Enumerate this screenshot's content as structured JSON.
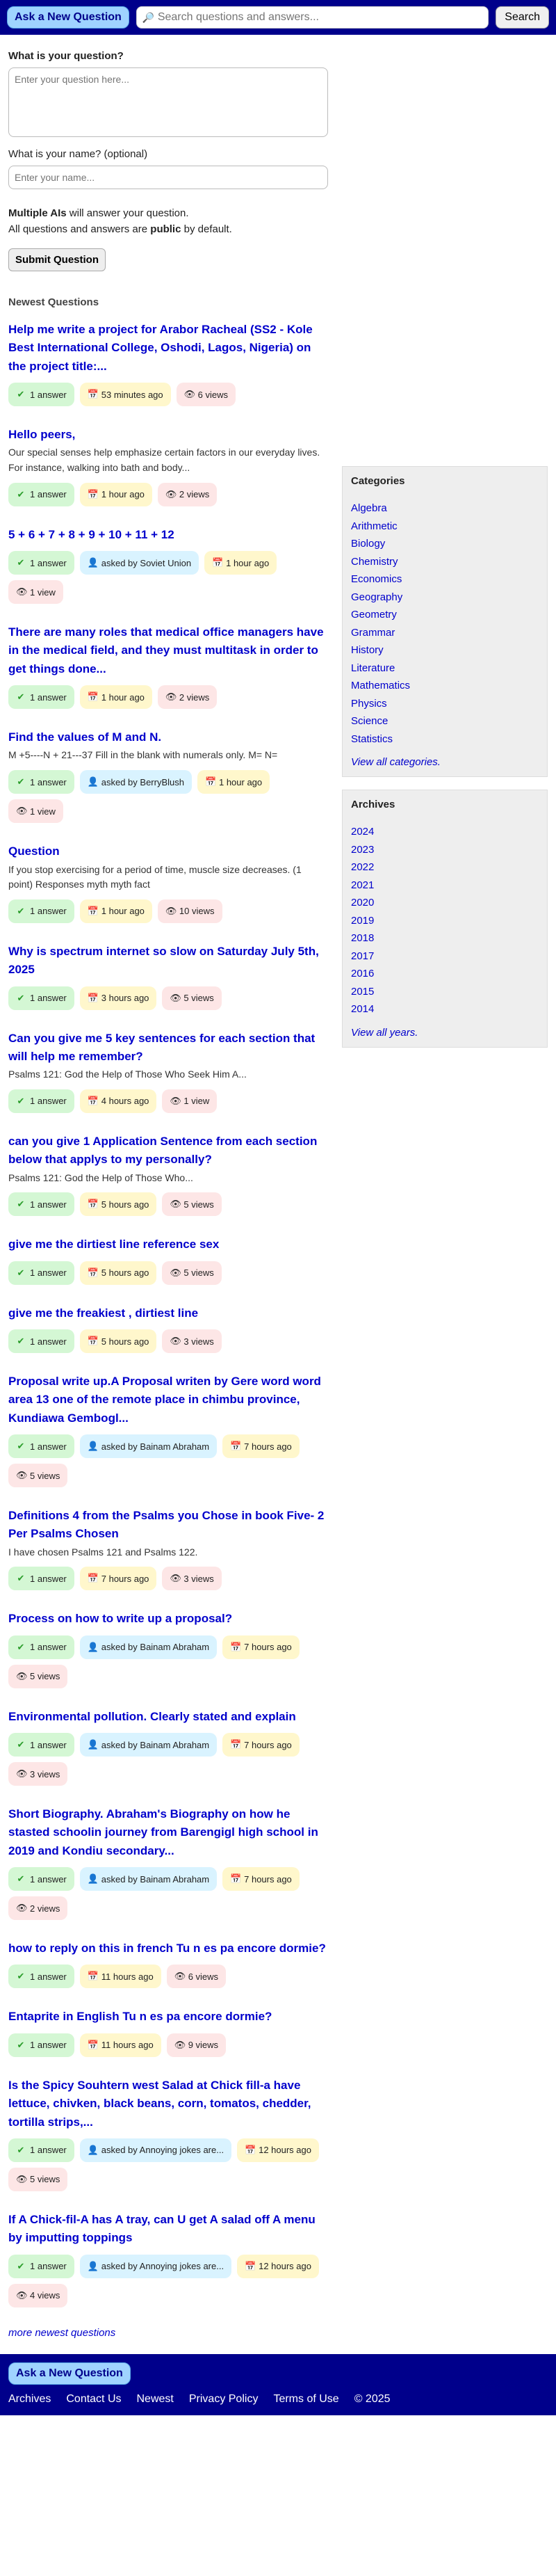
{
  "header": {
    "ask_label": "Ask a New Question",
    "search_placeholder": "Search questions and answers...",
    "search_button": "Search"
  },
  "form": {
    "question_label": "What is your question?",
    "question_placeholder": "Enter your question here...",
    "name_label": "What is your name? (optional)",
    "name_placeholder": "Enter your name...",
    "info_bold1": "Multiple AIs",
    "info_rest1": " will answer your question.",
    "info_pre2": "All questions and answers are ",
    "info_bold2": "public",
    "info_rest2": " by default.",
    "submit_label": "Submit Question"
  },
  "newest_title": "Newest Questions",
  "questions": [
    {
      "title": "Help me write a project for Arabor Racheal (SS2 - Kole Best International College, Oshodi, Lagos, Nigeria) on the project title:...",
      "answers": "1 answer",
      "time": "53 minutes ago",
      "views": "6 views"
    },
    {
      "title": "Hello peers,",
      "excerpt": "Our special senses help emphasize certain factors in our everyday lives. For instance, walking into bath and body...",
      "answers": "1 answer",
      "time": "1 hour ago",
      "views": "2 views"
    },
    {
      "title": "5 + 6 + 7 + 8 + 9 + 10 + 11 + 12",
      "answers": "1 answer",
      "user": "asked by Soviet Union",
      "time": "1 hour ago",
      "views": "1 view"
    },
    {
      "title": "There are many roles that medical office managers have in the medical field, and they must multitask in order to get things done...",
      "answers": "1 answer",
      "time": "1 hour ago",
      "views": "2 views"
    },
    {
      "title": "Find the values of M and N.",
      "excerpt": "M +5----N + 21---37 Fill in the blank with numerals only. M= N=",
      "answers": "1 answer",
      "user": "asked by BerryBlush",
      "time": "1 hour ago",
      "views": "1 view"
    },
    {
      "title": "Question",
      "excerpt": "If you stop exercising for a period of time, muscle size decreases. (1 point) Responses myth myth fact",
      "answers": "1 answer",
      "time": "1 hour ago",
      "views": "10 views"
    },
    {
      "title": "Why is spectrum internet so slow on Saturday July 5th, 2025",
      "answers": "1 answer",
      "time": "3 hours ago",
      "views": "5 views"
    },
    {
      "title": "Can you give me 5 key sentences for each section that will help me remember?",
      "excerpt": "Psalms 121: God the Help of Those Who Seek Him A...",
      "answers": "1 answer",
      "time": "4 hours ago",
      "views": "1 view"
    },
    {
      "title": "can you give 1 Application Sentence from each section below that applys to my personally?",
      "excerpt": "Psalms 121: God the Help of Those Who...",
      "answers": "1 answer",
      "time": "5 hours ago",
      "views": "5 views"
    },
    {
      "title": "give me the dirtiest line reference sex",
      "answers": "1 answer",
      "time": "5 hours ago",
      "views": "5 views"
    },
    {
      "title": "give me the freakiest , dirtiest line",
      "answers": "1 answer",
      "time": "5 hours ago",
      "views": "3 views"
    },
    {
      "title": "Proposal write up.A Proposal writen by Gere word word area 13 one of the remote place in chimbu province, Kundiawa Gembogl...",
      "answers": "1 answer",
      "user": "asked by Bainam Abraham",
      "time": "7 hours ago",
      "views": "5 views"
    },
    {
      "title": "Definitions 4 from the Psalms you Chose in book Five- 2 Per Psalms Chosen",
      "excerpt": "I have chosen Psalms 121 and Psalms 122.",
      "answers": "1 answer",
      "time": "7 hours ago",
      "views": "3 views"
    },
    {
      "title": "Process on how to write up a proposal?",
      "answers": "1 answer",
      "user": "asked by Bainam Abraham",
      "time": "7 hours ago",
      "views": "5 views"
    },
    {
      "title": "Environmental pollution. Clearly stated and explain",
      "answers": "1 answer",
      "user": "asked by Bainam Abraham",
      "time": "7 hours ago",
      "views": "3 views"
    },
    {
      "title": "Short Biography. Abraham's Biography on how he stasted schoolin journey from Barengigl high school in 2019 and Kondiu secondary...",
      "answers": "1 answer",
      "user": "asked by Bainam Abraham",
      "time": "7 hours ago",
      "views": "2 views"
    },
    {
      "title": "how to reply on this in french Tu n es pa encore dormie?",
      "answers": "1 answer",
      "time": "11 hours ago",
      "views": "6 views"
    },
    {
      "title": "Entaprite in English Tu n es pa encore dormie?",
      "answers": "1 answer",
      "time": "11 hours ago",
      "views": "9 views"
    },
    {
      "title": "Is the Spicy Souhtern west Salad at Chick fill-a have lettuce, chivken, black beans, corn, tomatos, chedder, tortilla strips,...",
      "answers": "1 answer",
      "user": "asked by Annoying jokes are...",
      "time": "12 hours ago",
      "views": "5 views"
    },
    {
      "title": "If A Chick-fil-A has A tray, can U get A salad off A menu by imputting toppings",
      "answers": "1 answer",
      "user": "asked by Annoying jokes are...",
      "time": "12 hours ago",
      "views": "4 views"
    }
  ],
  "more_label": "more newest questions",
  "categories": {
    "title": "Categories",
    "items": [
      "Algebra",
      "Arithmetic",
      "Biology",
      "Chemistry",
      "Economics",
      "Geography",
      "Geometry",
      "Grammar",
      "History",
      "Literature",
      "Mathematics",
      "Physics",
      "Science",
      "Statistics"
    ],
    "view_all": "View all categories."
  },
  "archives": {
    "title": "Archives",
    "items": [
      "2024",
      "2023",
      "2022",
      "2021",
      "2020",
      "2019",
      "2018",
      "2017",
      "2016",
      "2015",
      "2014"
    ],
    "view_all": "View all years."
  },
  "footer": {
    "ask_label": "Ask a New Question",
    "links": [
      "Archives",
      "Contact Us",
      "Newest",
      "Privacy Policy",
      "Terms of Use"
    ],
    "copyright": "© 2025"
  },
  "icons": {
    "answers": "check-icon",
    "user": "user-icon",
    "time": "calendar-icon",
    "views": "eye-icon",
    "search": "search-icon"
  }
}
